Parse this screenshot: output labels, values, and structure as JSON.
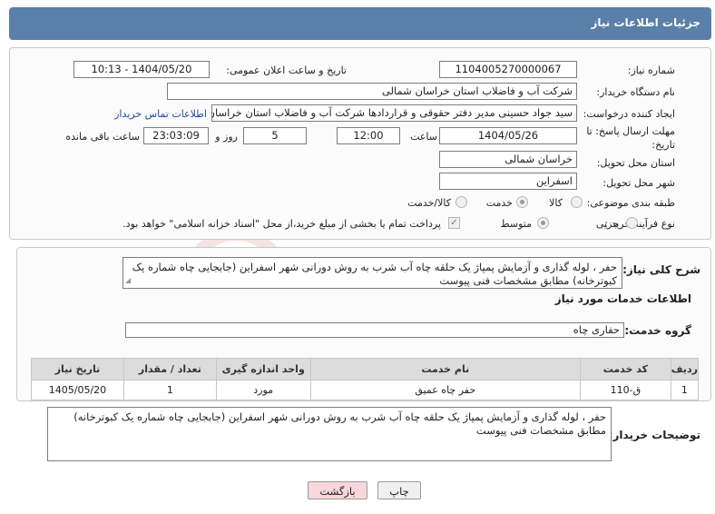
{
  "header": {
    "title": "جزئیات اطلاعات نیاز"
  },
  "need_number": {
    "label": "شماره نیاز:",
    "value": "1104005270000067"
  },
  "announce_datetime": {
    "label": "تاریخ و ساعت اعلان عمومی:",
    "value": "1404/05/20 - 10:13"
  },
  "buyer_org": {
    "label": "نام دستگاه خریدار:",
    "value": "شرکت آب و فاضلاب استان خراسان شمالی"
  },
  "requester": {
    "label": "ایجاد کننده درخواست:",
    "value": "سید جواد حسینی مدیر دفتر حقوقی و قراردادها  شرکت آب و فاضلاب استان خراسان شمالی",
    "contact_link": "اطلاعات تماس خریدار"
  },
  "deadline": {
    "label_line1": "مهلت ارسال پاسخ: تا",
    "label_line2": "تاریخ:",
    "date": "1404/05/26",
    "time_label": "ساعت",
    "time": "12:00",
    "days": "5",
    "days_label": "روز و",
    "remaining": "23:03:09",
    "remaining_label": "ساعت باقی مانده"
  },
  "delivery_province": {
    "label": "استان محل تحویل:",
    "value": "خراسان شمالی"
  },
  "delivery_city": {
    "label": "شهر محل تحویل:",
    "value": "اسفراین"
  },
  "category": {
    "label": "طبقه بندی موضوعی:",
    "options": [
      "کالا",
      "خدمت",
      "کالا/خدمت"
    ],
    "selected": "خدمت"
  },
  "purchase_type": {
    "label": "نوع فرآیند خرید :",
    "options": [
      "جزیی",
      "متوسط"
    ],
    "selected": "متوسط",
    "note": "پرداخت تمام یا بخشی از مبلغ خرید،از محل \"اسناد خزانه اسلامی\" خواهد بود."
  },
  "summary": {
    "label": "شرح کلی نیاز:",
    "value": "حفر ، لوله گذاری و آزمایش پمپاژ یک حلقه چاه آب شرب به روش دورانی شهر اسفراین (جابجایی چاه شماره یک کبوترخانه) مطابق مشخصات فنی پیوست"
  },
  "services_title": "اطلاعات خدمات مورد نیاز",
  "service_group": {
    "label": "گروه خدمت:",
    "value": "حفاری چاه"
  },
  "table": {
    "headers": [
      "ردیف",
      "کد خدمت",
      "نام خدمت",
      "واحد اندازه گیری",
      "تعداد / مقدار",
      "تاریخ نیاز"
    ],
    "rows": [
      [
        "1",
        "ق-110",
        "حفر چاه عمیق",
        "مورد",
        "1",
        "1405/05/20"
      ]
    ]
  },
  "buyer_notes": {
    "label": "توضیحات خریدار:",
    "value": "حفر ، لوله گذاری و آزمایش پمپاژ یک حلقه چاه آب شرب به روش دورانی شهر اسفراین (جابجایی چاه شماره یک کبوترخانه) مطابق مشخصات فنی پیوست"
  },
  "buttons": {
    "print": "چاپ",
    "back": "بازگشت"
  },
  "watermark_text": "AriaTender.net",
  "colors": {
    "header": "#5a7fa8",
    "link": "#1a4fa0",
    "back_button": "#f7d7dc",
    "print_button": "#f0f0f0",
    "watermark": "#c62828"
  }
}
